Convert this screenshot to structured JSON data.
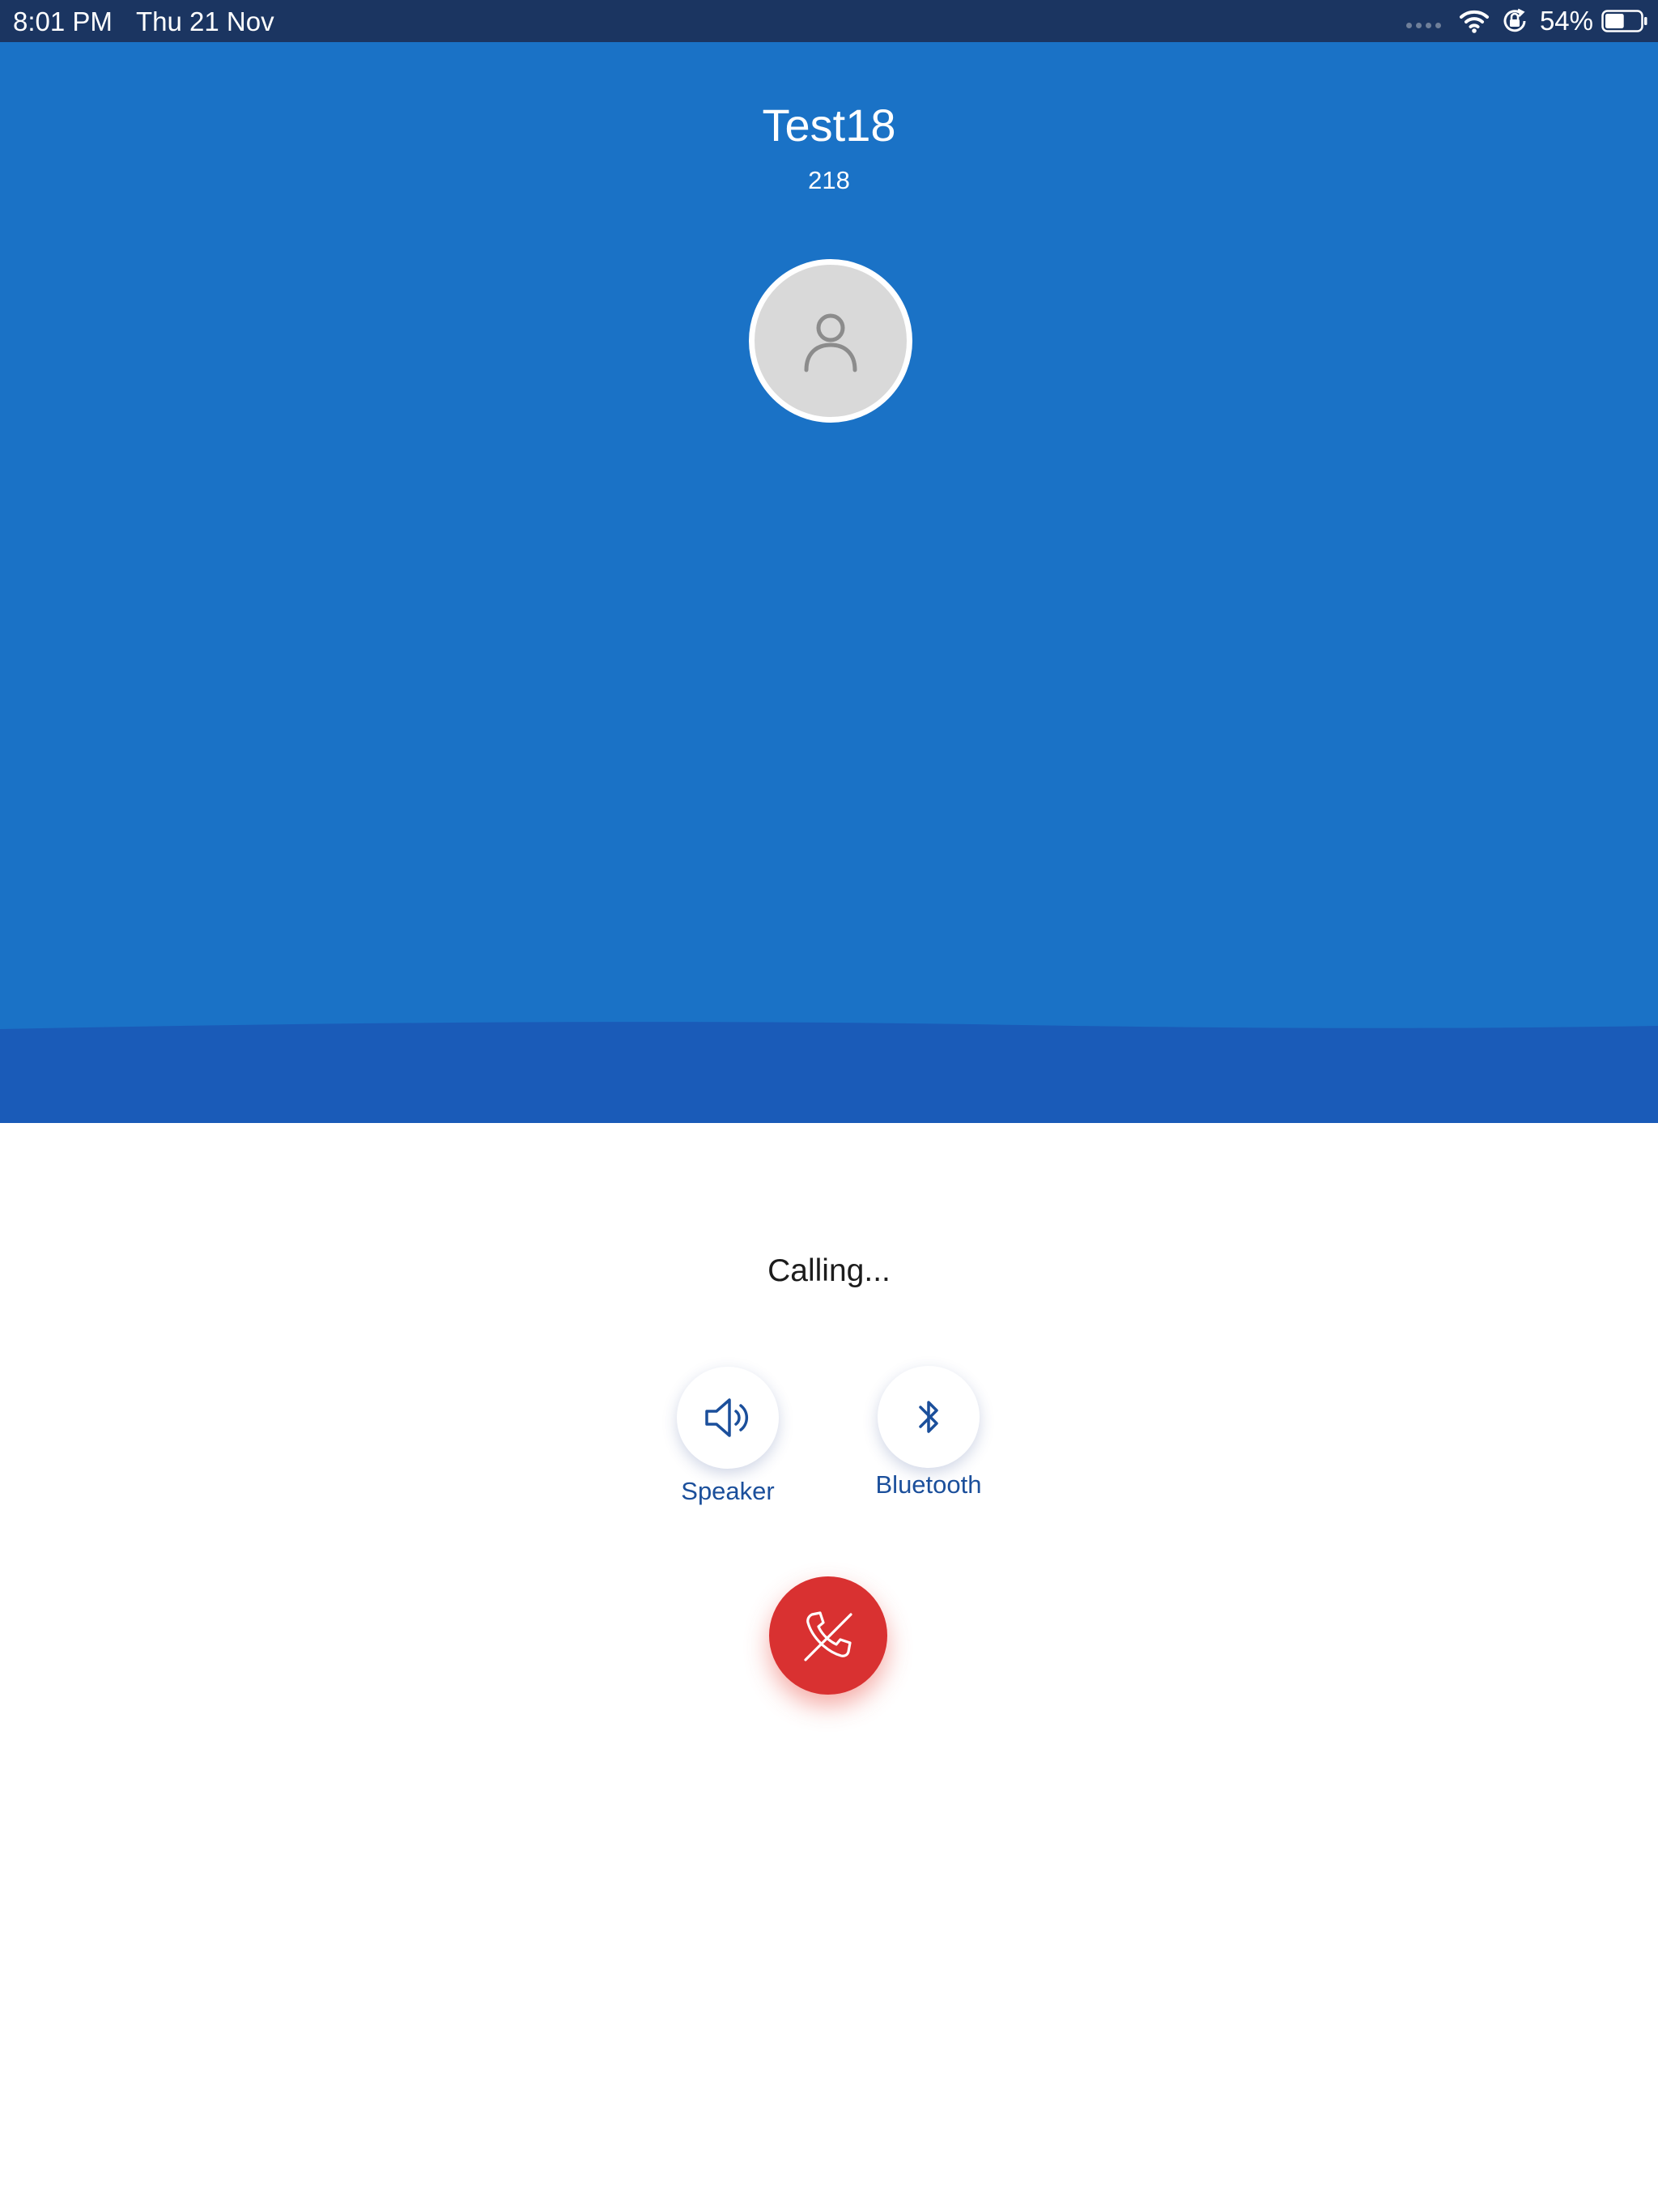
{
  "status_bar": {
    "time": "8:01 PM",
    "date": "Thu 21 Nov",
    "battery_percent": "54%",
    "battery_level": 0.54,
    "icons": [
      "cellular-signal-icon",
      "wifi-icon",
      "orientation-lock-icon",
      "battery-icon"
    ]
  },
  "contact": {
    "name": "Test18",
    "extension": "218",
    "avatar_icon": "person-icon"
  },
  "call": {
    "status": "Calling..."
  },
  "controls": {
    "speaker": {
      "label": "Speaker",
      "icon": "speaker-icon"
    },
    "bluetooth": {
      "label": "Bluetooth",
      "icon": "bluetooth-icon"
    },
    "end_call": {
      "icon": "end-call-icon"
    }
  },
  "colors": {
    "status_bar": "#1b3561",
    "hero_background": "#1a72c6",
    "hero_wave": "#1a5bb8",
    "control_text": "#1b4f9b",
    "end_call": "#d93131"
  }
}
